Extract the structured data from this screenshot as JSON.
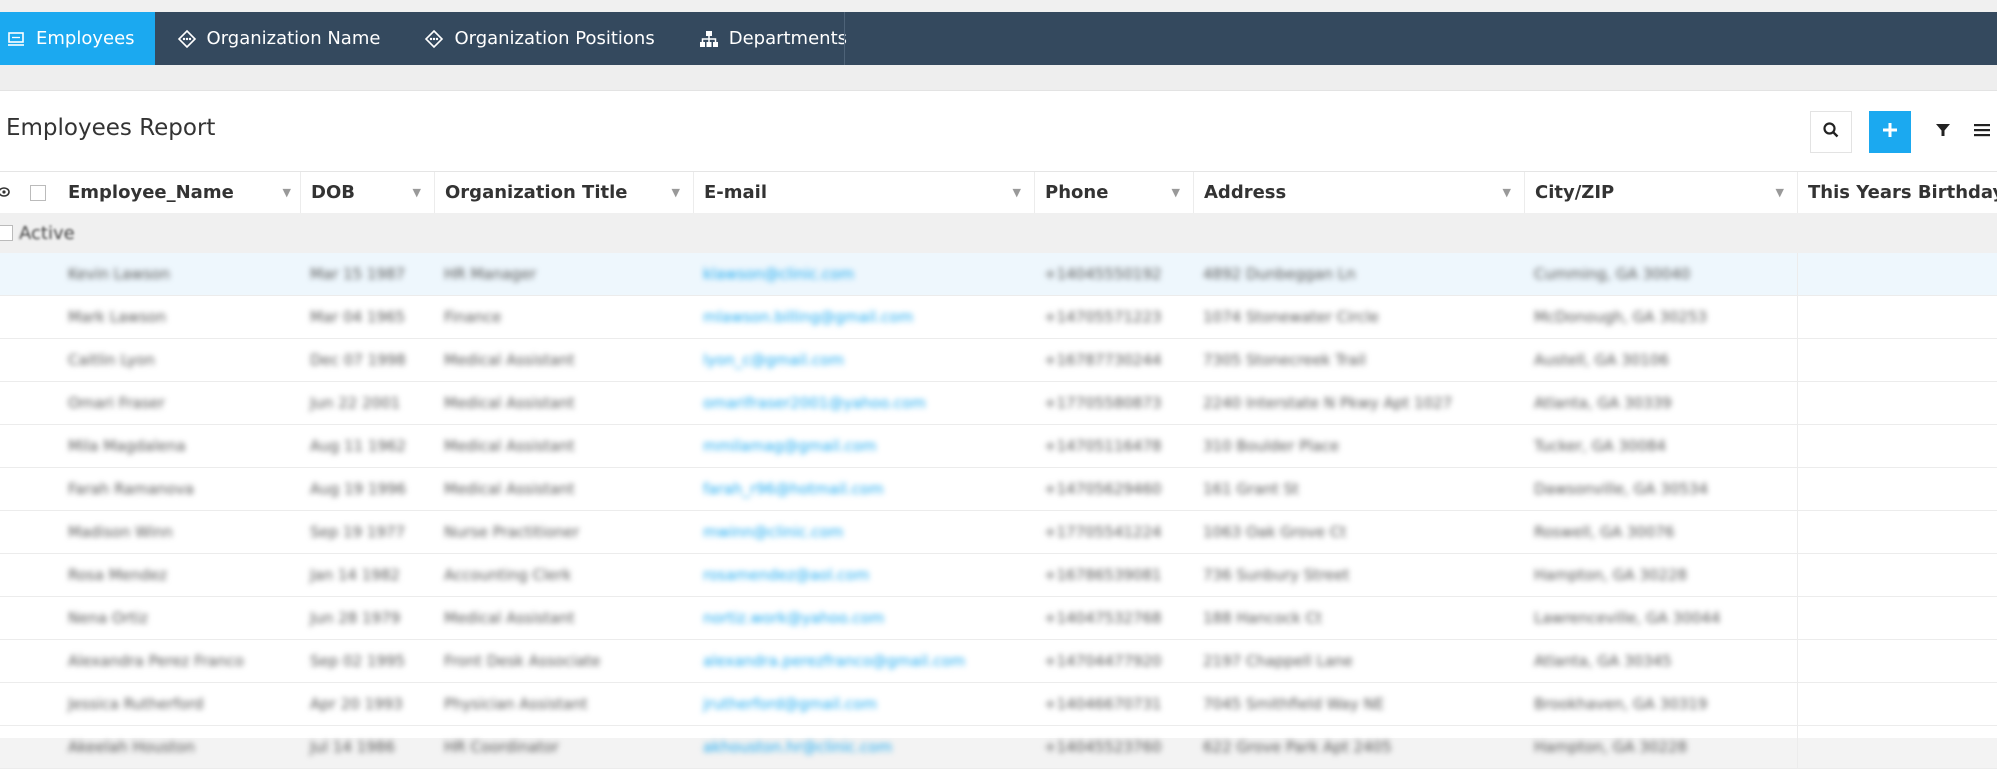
{
  "nav": {
    "tabs": [
      {
        "label": "Employees",
        "icon": "monitor-icon",
        "active": true
      },
      {
        "label": "Organization Name",
        "icon": "org-icon",
        "active": false
      },
      {
        "label": "Organization Positions",
        "icon": "org-icon",
        "active": false
      },
      {
        "label": "Departments",
        "icon": "sitemap-icon",
        "active": false
      }
    ]
  },
  "report": {
    "title": "Employees Report",
    "tools": [
      "search-icon",
      "plus-icon",
      "filter-icon",
      "menu-icon"
    ]
  },
  "table": {
    "columns": [
      "Employee_Name",
      "DOB",
      "Organization Title",
      "E-mail",
      "Phone",
      "Address",
      "City/ZIP",
      "This Years Birthday"
    ],
    "group_label": "Active",
    "rows": [
      [
        "Kevin Lawson",
        "Mar 15 1987",
        "HR Manager",
        "klawson@clinic.com",
        "+14045550192",
        "4892 Dunbeggan Ln",
        "Cumming, GA 30040",
        ""
      ],
      [
        "Mark Lawson",
        "Mar 04 1965",
        "Finance",
        "mlawson.billing@gmail.com",
        "+14705571223",
        "1074 Stonewater Circle",
        "McDonough, GA 30253",
        ""
      ],
      [
        "Caitlin Lyon",
        "Dec 07 1998",
        "Medical Assistant",
        "lyon_c@gmail.com",
        "+16787730244",
        "7305 Stonecreek Trail",
        "Austell, GA 30106",
        ""
      ],
      [
        "Omari Fraser",
        "Jun 22 2001",
        "Medical Assistant",
        "omarifraser2001@yahoo.com",
        "+17705580873",
        "2240 Interstate N Pkwy Apt 1027",
        "Atlanta, GA 30339",
        ""
      ],
      [
        "Mila Magdalena",
        "Aug 11 1962",
        "Medical Assistant",
        "mmilamag@gmail.com",
        "+14705116478",
        "310 Boulder Place",
        "Tucker, GA 30084",
        ""
      ],
      [
        "Farah Ramanova",
        "Aug 19 1996",
        "Medical Assistant",
        "farah_r96@hotmail.com",
        "+14705629460",
        "161 Grant St",
        "Dawsonville, GA 30534",
        ""
      ],
      [
        "Madison Winn",
        "Sep 19 1977",
        "Nurse Practitioner",
        "mwinn@clinic.com",
        "+17705541224",
        "1063 Oak Grove Ct",
        "Roswell, GA 30076",
        ""
      ],
      [
        "Rosa Mendez",
        "Jan 14 1982",
        "Accounting Clerk",
        "rosamendez@aol.com",
        "+16786539081",
        "736 Sunbury Street",
        "Hampton, GA 30228",
        ""
      ],
      [
        "Nena Ortiz",
        "Jun 28 1979",
        "Medical Assistant",
        "nortiz.work@yahoo.com",
        "+14047532768",
        "188 Hancock Ct",
        "Lawrenceville, GA 30044",
        ""
      ],
      [
        "Alexandra Perez Franco",
        "Sep 02 1995",
        "Front Desk Associate",
        "alexandra.perezfranco@gmail.com",
        "+14704477920",
        "2197 Chappell Lane",
        "Atlanta, GA 30345",
        ""
      ],
      [
        "Jessica Rutherford",
        "Apr 20 1993",
        "Physician Assistant",
        "jrutherford@gmail.com",
        "+14046670731",
        "7045 Smithfield Way NE",
        "Brookhaven, GA 30319",
        ""
      ],
      [
        "Akeelah Houston",
        "Jul 14 1986",
        "HR Coordinator",
        "akhouston.hr@clinic.com",
        "+14045523760",
        "622 Grove Park Apt 2405",
        "Hampton, GA 30228",
        ""
      ]
    ]
  }
}
